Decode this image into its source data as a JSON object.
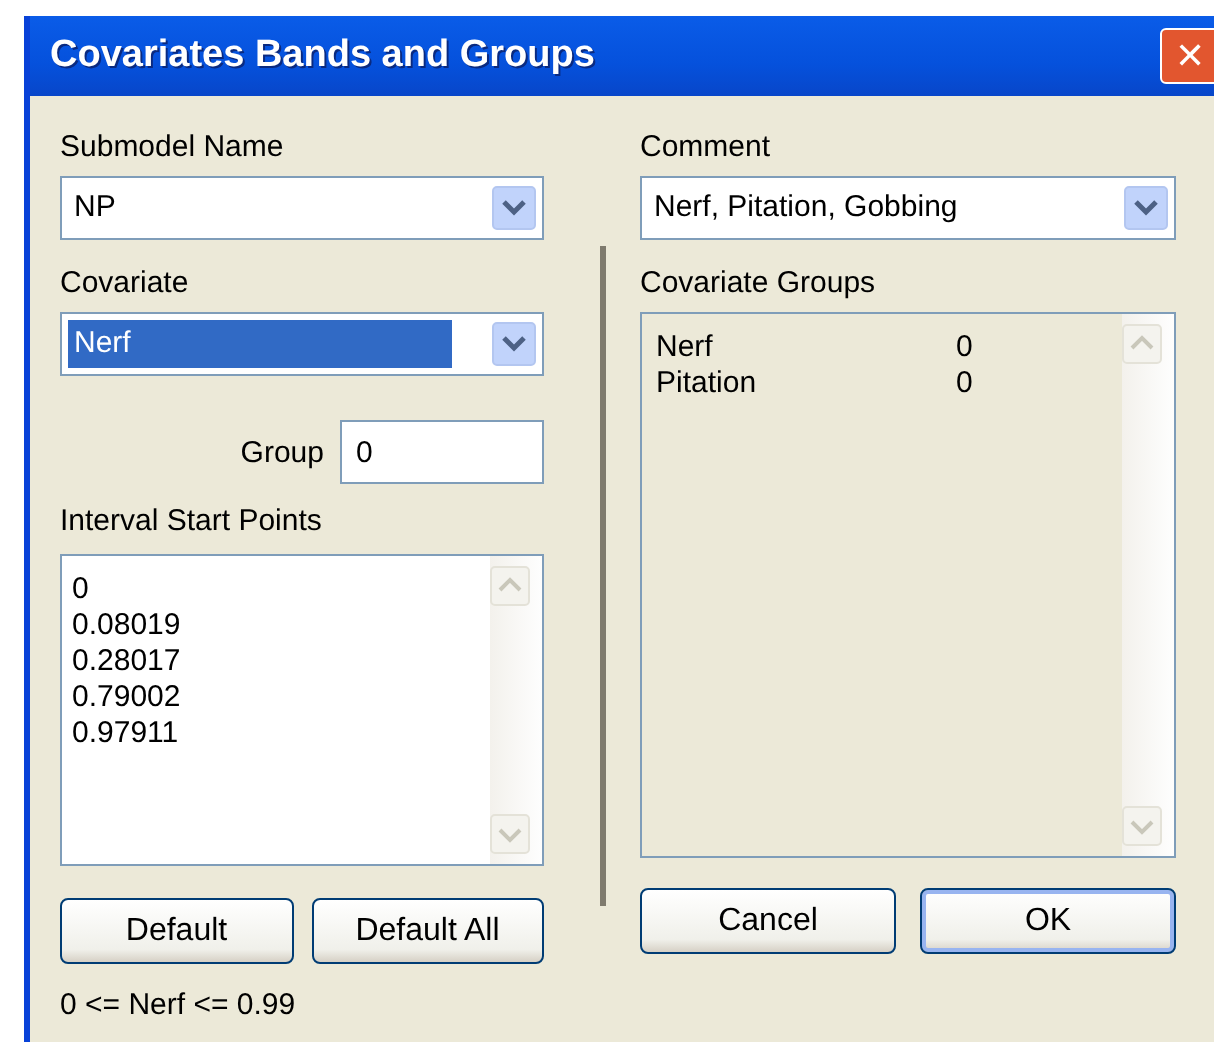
{
  "window": {
    "title": "Covariates Bands and Groups",
    "close": "✕"
  },
  "submodel": {
    "label": "Submodel Name",
    "value": "NP"
  },
  "comment": {
    "label": "Comment",
    "value": "Nerf, Pitation, Gobbing"
  },
  "covariate": {
    "label": "Covariate",
    "value": "Nerf",
    "highlighted": true
  },
  "group": {
    "label": "Group",
    "value": "0"
  },
  "intervals": {
    "label": "Interval Start Points",
    "items": [
      "0",
      "0.08019",
      "0.28017",
      "0.79002",
      "0.97911"
    ]
  },
  "left_buttons": [
    {
      "label": "Default",
      "default": false
    },
    {
      "label": "Default All",
      "default": false
    }
  ],
  "range": "0 <= Nerf <= 0.99",
  "covariate_groups": {
    "label": "Covariate Groups",
    "rows": [
      {
        "name": "Nerf",
        "group": "0"
      },
      {
        "name": "Pitation",
        "group": "0"
      }
    ]
  },
  "right_buttons": [
    {
      "label": "Cancel",
      "default": false
    },
    {
      "label": "OK",
      "default": true
    }
  ]
}
